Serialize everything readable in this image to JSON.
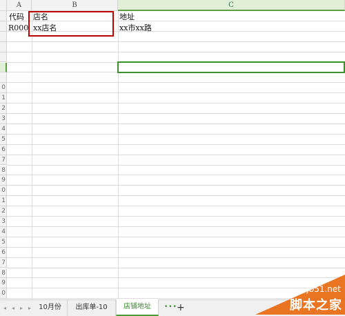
{
  "columns": [
    "A",
    "B",
    "C"
  ],
  "rows": [
    "",
    "",
    "",
    "",
    "",
    "",
    "",
    "0",
    "1",
    "2",
    "3",
    "4",
    "5",
    "6",
    "7",
    "8",
    "9",
    "0",
    "1",
    "2",
    "3",
    "4",
    "5",
    "6",
    "7",
    "8",
    "9",
    "0"
  ],
  "cells": {
    "a1": "代码",
    "b1": "店名",
    "c1": "地址",
    "a2": "R000",
    "b2": "xx店名",
    "c2": "xx市xx路"
  },
  "tabs": {
    "sheet1": "10月份",
    "sheet2": "出库单-10",
    "sheet3": "店铺地址",
    "more": "•••",
    "add": "+"
  },
  "nav": [
    "◂",
    "◂",
    "▸",
    "▸"
  ],
  "watermark": {
    "domain": "jb51.net",
    "name": "脚本之家"
  },
  "colors": {
    "highlight": "#c00000",
    "active_cell": "#3c8f2d",
    "active_tab": "#3a8a2d",
    "watermark": "#e86a10"
  }
}
